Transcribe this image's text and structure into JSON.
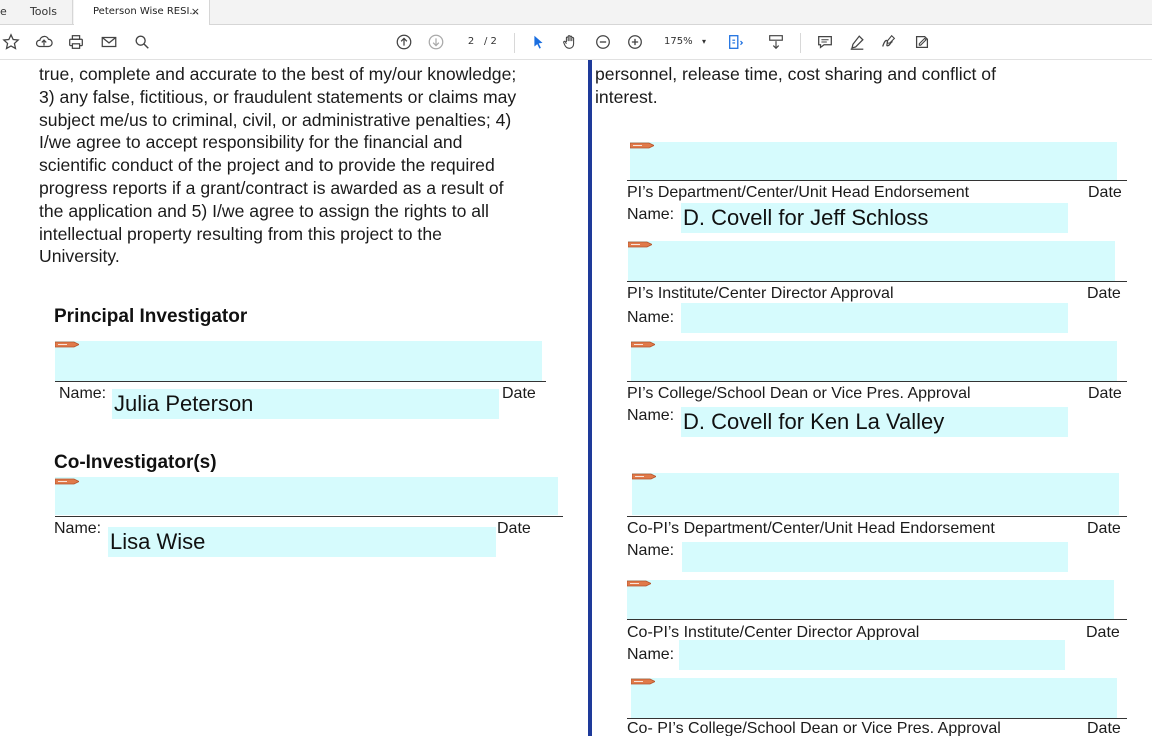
{
  "window": {
    "tabs": [
      {
        "label": "e"
      },
      {
        "label": "Tools"
      },
      {
        "label": "Peterson Wise RESI...",
        "close": "×"
      }
    ]
  },
  "toolbar": {
    "page_current": "2",
    "page_total": "/ 2",
    "zoom": "175%",
    "zoom_caret": "▾",
    "icons": [
      "star-icon",
      "cloud-upload-icon",
      "print-icon",
      "mail-icon",
      "search-icon",
      "page-up-icon",
      "page-down-icon",
      "select-cursor-icon",
      "hand-icon",
      "zoom-out-icon",
      "zoom-in-icon",
      "fit-page-icon",
      "scroll-mode-icon",
      "comment-icon",
      "highlight-icon",
      "sign-icon",
      "fill-sign-icon"
    ],
    "accent_color": "#1a6ee0"
  },
  "document": {
    "left_paragraph": "true, complete and accurate to the best of my/our knowledge;\n3) any false, fictitious, or fraudulent statements or claims may\nsubject me/us to criminal, civil, or administrative penalties; 4)\nI/we agree to accept responsibility for the financial and\nscientific conduct of the project and to provide the required\nprogress reports if a grant/contract is awarded as a result of\nthe application and 5) I/we agree to assign the rights to all\nintellectual property resulting from this project to the\nUniversity.",
    "right_paragraph": "personnel, release time, cost sharing and conflict of\ninterest.",
    "pi_heading": "Principal Investigator",
    "co_heading": "Co-Investigator(s)",
    "name_label": "Name:",
    "date_label": "Date",
    "pi_name": "Julia Peterson",
    "co_name": "Lisa Wise",
    "approvals": [
      {
        "title": "PI’s Department/Center/Unit Head Endorsement",
        "name": "D. Covell for Jeff Schloss"
      },
      {
        "title": "PI’s Institute/Center Director Approval",
        "name": ""
      },
      {
        "title": "PI’s College/School Dean or Vice Pres. Approval",
        "name": "D. Covell for Ken La Valley"
      },
      {
        "title": "Co-PI’s Department/Center/Unit Head Endorsement",
        "name": ""
      },
      {
        "title": "Co-PI’s Institute/Center Director Approval",
        "name": ""
      },
      {
        "title": "Co- PI’s College/School Dean or Vice Pres. Approval",
        "name": ""
      }
    ],
    "field_color": "#d6fbfd",
    "divider_color": "#1e3a9a"
  }
}
